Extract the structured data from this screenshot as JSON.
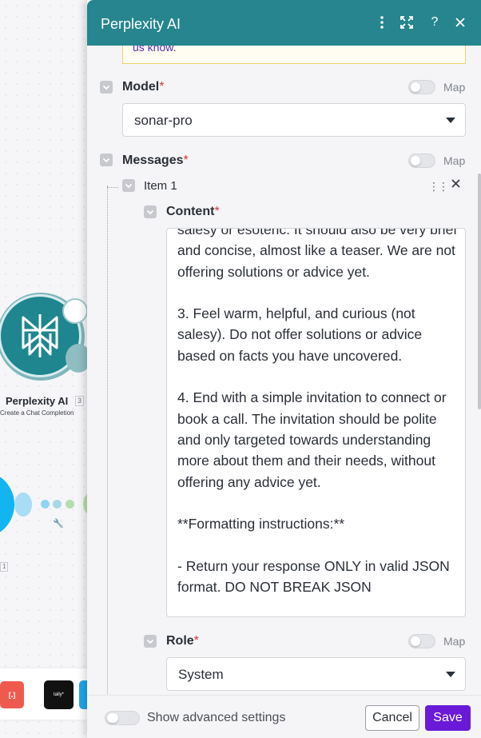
{
  "canvas": {
    "node_title": "Perplexity AI",
    "node_badge": "3",
    "node_subtitle": "Create a Chat Completion",
    "small_badge": "1",
    "toolbar_red_label": "[.]",
    "toolbar_tally_label": "tally*"
  },
  "panel": {
    "title": "Perplexity AI",
    "header_icons": [
      "more-vertical-icon",
      "expand-icon",
      "help-icon",
      "close-icon"
    ],
    "help_label": "?",
    "notice_link": "us know",
    "notice_suffix": ".",
    "model": {
      "label": "Model",
      "required_mark": "*",
      "map_label": "Map",
      "value": "sonar-pro"
    },
    "messages": {
      "label": "Messages",
      "required_mark": "*",
      "map_label": "Map",
      "item": {
        "label": "Item 1",
        "content": {
          "label": "Content",
          "required_mark": "*",
          "text": "salesy or esoteric. It should also be very brief and concise, almost like a teaser. We are not offering solutions or advice yet.\n\n3. Feel warm, helpful, and curious (not salesy). Do not offer solutions or advice based on facts you have uncovered.\n\n4. End with a simple invitation to connect or book a call. The invitation should be polite and only targeted towards understanding more about them and their needs, without offering any advice yet.\n\n**Formatting instructions:**\n\n- Return your response ONLY in valid JSON format. DO NOT BREAK JSON"
        },
        "role": {
          "label": "Role",
          "required_mark": "*",
          "map_label": "Map",
          "value": "System"
        }
      }
    },
    "footer": {
      "advanced_label": "Show advanced settings",
      "cancel_label": "Cancel",
      "save_label": "Save"
    }
  },
  "colors": {
    "header": "#26858e",
    "save_button": "#6a1ad6",
    "required": "#d63838",
    "notice_link": "#5b2ab8"
  }
}
